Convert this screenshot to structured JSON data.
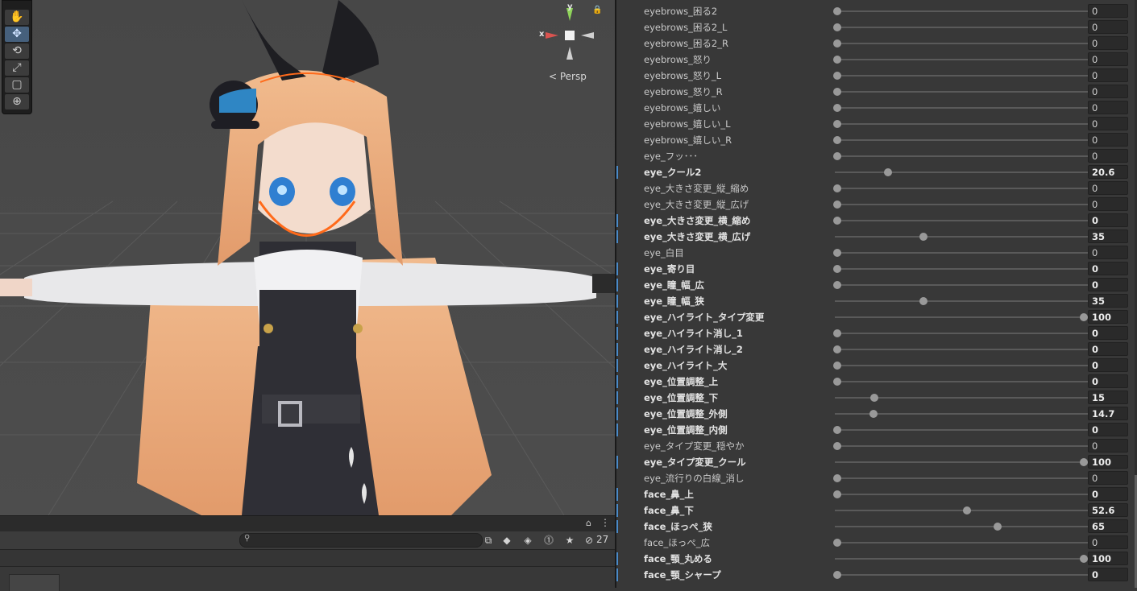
{
  "scene": {
    "persp_label": "< Persp",
    "axes": {
      "x": "x",
      "y": "y"
    },
    "tools": [
      "hand-tool",
      "move-tool",
      "rotate-tool",
      "scale-tool",
      "rect-tool",
      "transform-tool"
    ],
    "active_tool": "move-tool"
  },
  "bottom_toolbar": {
    "search_placeholder": "",
    "hidden_count": "27"
  },
  "blendshapes": [
    {
      "label": "eyebrows_困る2",
      "value": "0",
      "fraction": 0,
      "modified": false
    },
    {
      "label": "eyebrows_困る2_L",
      "value": "0",
      "fraction": 0,
      "modified": false
    },
    {
      "label": "eyebrows_困る2_R",
      "value": "0",
      "fraction": 0,
      "modified": false
    },
    {
      "label": "eyebrows_怒り",
      "value": "0",
      "fraction": 0,
      "modified": false
    },
    {
      "label": "eyebrows_怒り_L",
      "value": "0",
      "fraction": 0,
      "modified": false
    },
    {
      "label": "eyebrows_怒り_R",
      "value": "0",
      "fraction": 0,
      "modified": false
    },
    {
      "label": "eyebrows_嬉しい",
      "value": "0",
      "fraction": 0,
      "modified": false
    },
    {
      "label": "eyebrows_嬉しい_L",
      "value": "0",
      "fraction": 0,
      "modified": false
    },
    {
      "label": "eyebrows_嬉しい_R",
      "value": "0",
      "fraction": 0,
      "modified": false
    },
    {
      "label": "eye_フッ･･･",
      "value": "0",
      "fraction": 0,
      "modified": false
    },
    {
      "label": "eye_クール2",
      "value": "20.6",
      "fraction": 0.206,
      "modified": true
    },
    {
      "label": "eye_大きさ変更_縦_縮め",
      "value": "0",
      "fraction": 0,
      "modified": false
    },
    {
      "label": "eye_大きさ変更_縦_広げ",
      "value": "0",
      "fraction": 0,
      "modified": false
    },
    {
      "label": "eye_大きさ変更_横_縮め",
      "value": "0",
      "fraction": 0,
      "modified": true
    },
    {
      "label": "eye_大きさ変更_横_広げ",
      "value": "35",
      "fraction": 0.35,
      "modified": true
    },
    {
      "label": "eye_白目",
      "value": "0",
      "fraction": 0,
      "modified": false
    },
    {
      "label": "eye_寄り目",
      "value": "0",
      "fraction": 0,
      "modified": true
    },
    {
      "label": "eye_瞳_幅_広",
      "value": "0",
      "fraction": 0,
      "modified": true
    },
    {
      "label": "eye_瞳_幅_狭",
      "value": "35",
      "fraction": 0.35,
      "modified": true
    },
    {
      "label": "eye_ハイライト_タイプ変更",
      "value": "100",
      "fraction": 1,
      "modified": true
    },
    {
      "label": "eye_ハイライト消し_1",
      "value": "0",
      "fraction": 0,
      "modified": true
    },
    {
      "label": "eye_ハイライト消し_2",
      "value": "0",
      "fraction": 0,
      "modified": true
    },
    {
      "label": "eye_ハイライト_大",
      "value": "0",
      "fraction": 0,
      "modified": true
    },
    {
      "label": "eye_位置調整_上",
      "value": "0",
      "fraction": 0,
      "modified": true
    },
    {
      "label": "eye_位置調整_下",
      "value": "15",
      "fraction": 0.15,
      "modified": true
    },
    {
      "label": "eye_位置調整_外側",
      "value": "14.7",
      "fraction": 0.147,
      "modified": true
    },
    {
      "label": "eye_位置調整_内側",
      "value": "0",
      "fraction": 0,
      "modified": true
    },
    {
      "label": "eye_タイプ変更_穏やか",
      "value": "0",
      "fraction": 0,
      "modified": false
    },
    {
      "label": "eye_タイプ変更_クール",
      "value": "100",
      "fraction": 1,
      "modified": true
    },
    {
      "label": "eye_流行りの白線_消し",
      "value": "0",
      "fraction": 0,
      "modified": false
    },
    {
      "label": "face_鼻_上",
      "value": "0",
      "fraction": 0,
      "modified": true
    },
    {
      "label": "face_鼻_下",
      "value": "52.6",
      "fraction": 0.526,
      "modified": true
    },
    {
      "label": "face_ほっぺ_狭",
      "value": "65",
      "fraction": 0.65,
      "modified": true
    },
    {
      "label": "face_ほっぺ_広",
      "value": "0",
      "fraction": 0,
      "modified": false
    },
    {
      "label": "face_顎_丸める",
      "value": "100",
      "fraction": 1,
      "modified": true
    },
    {
      "label": "face_顎_シャープ",
      "value": "0",
      "fraction": 0,
      "modified": true
    }
  ],
  "colors": {
    "accent": "#4a8ac8",
    "orange_outline": "#ff6a1a",
    "hair": "#e9a97a"
  }
}
